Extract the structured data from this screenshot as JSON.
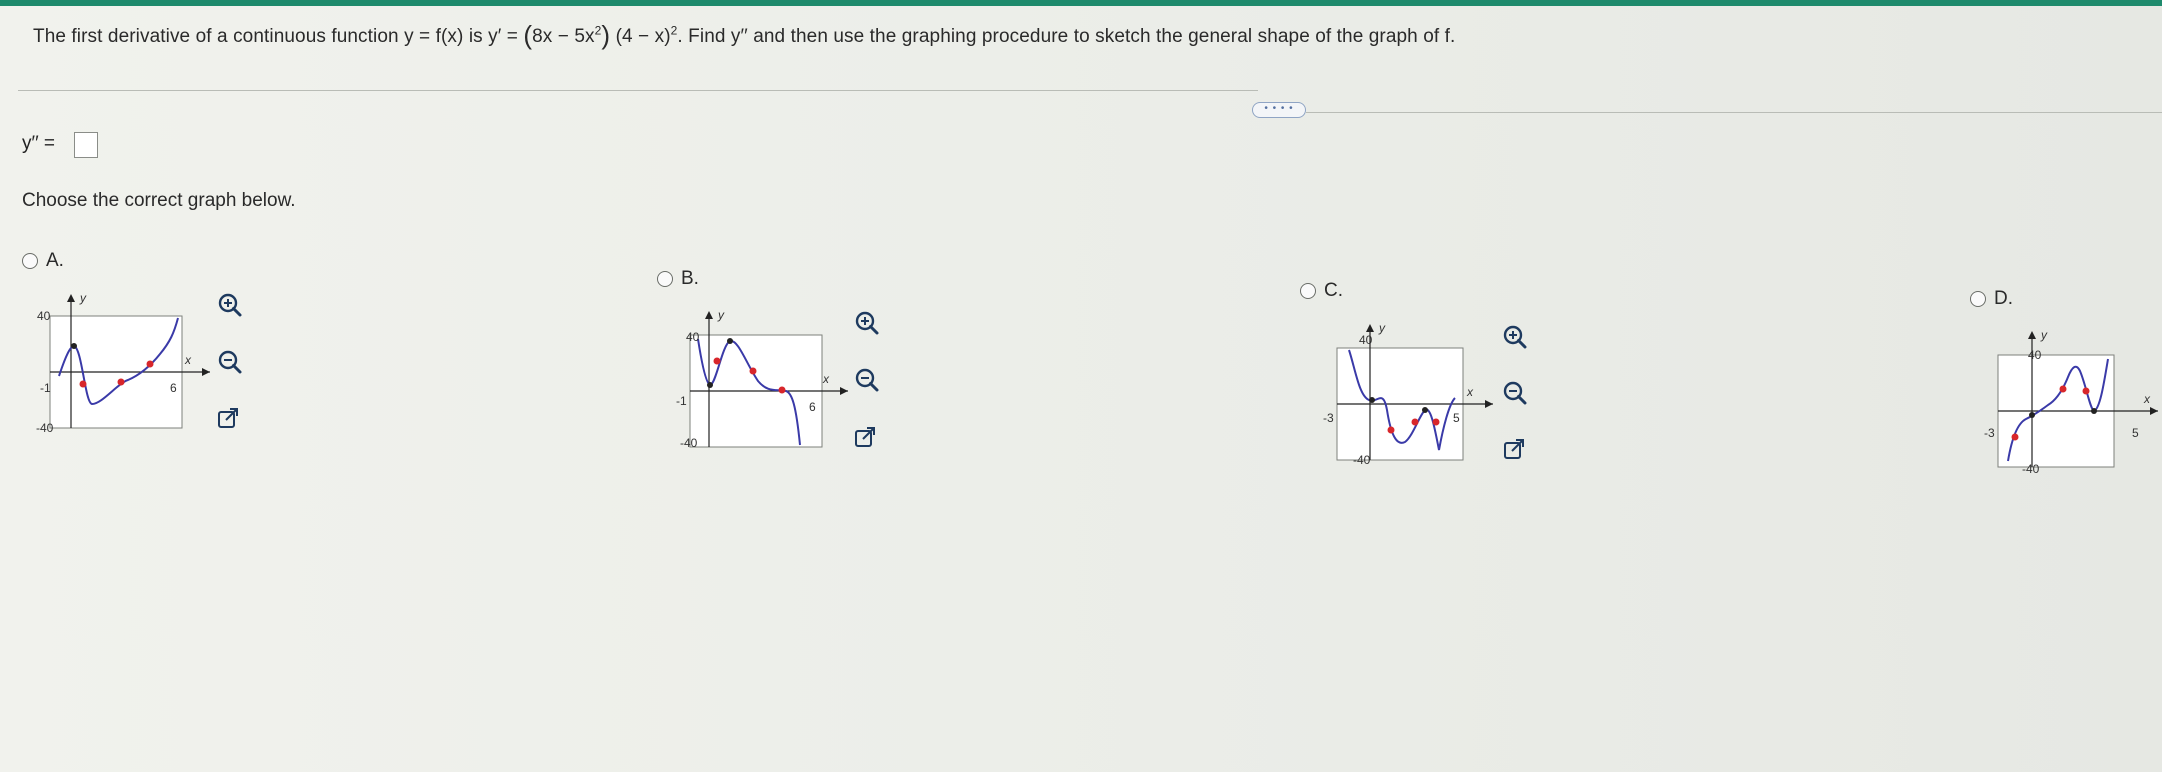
{
  "question": {
    "intro": "The first derivative of a continuous function y = f(x) is y′ = ",
    "factor1": "8x − 5x",
    "factor1_exp": "2",
    "factor2": "(4 − x)",
    "factor2_exp": "2",
    "tail": ". Find y′′ and then use the graphing procedure to sketch the general shape of the graph of f."
  },
  "more_button": "• • • •",
  "answer_label": "y′′ =",
  "instruction": "Choose the correct graph below.",
  "options": [
    {
      "letter": "A.",
      "xmin_label": "-1",
      "xmax_label": "6",
      "ymax_label": "40",
      "ymin_label": "-40",
      "x_axis_label": "x",
      "y_axis_label": "y"
    },
    {
      "letter": "B.",
      "xmin_label": "-1",
      "xmax_label": "6",
      "ymax_label": "40",
      "ymin_label": "-40",
      "x_axis_label": "x",
      "y_axis_label": "y"
    },
    {
      "letter": "C.",
      "xmin_label": "-3",
      "xmax_label": "5",
      "ymax_label": "40",
      "ymin_label": "-40",
      "x_axis_label": "x",
      "y_axis_label": "y"
    },
    {
      "letter": "D.",
      "xmin_label": "-3",
      "xmax_label": "5",
      "ymax_label": "40",
      "ymin_label": "-40",
      "x_axis_label": "x",
      "y_axis_label": "y"
    }
  ],
  "colors": {
    "curve": "#3a3aa8",
    "point": "#d8262b",
    "accent": "#1e8a6c",
    "frame": "#7d807b"
  },
  "icons": [
    "zoom-in-icon",
    "zoom-out-icon",
    "open-new-window-icon"
  ]
}
